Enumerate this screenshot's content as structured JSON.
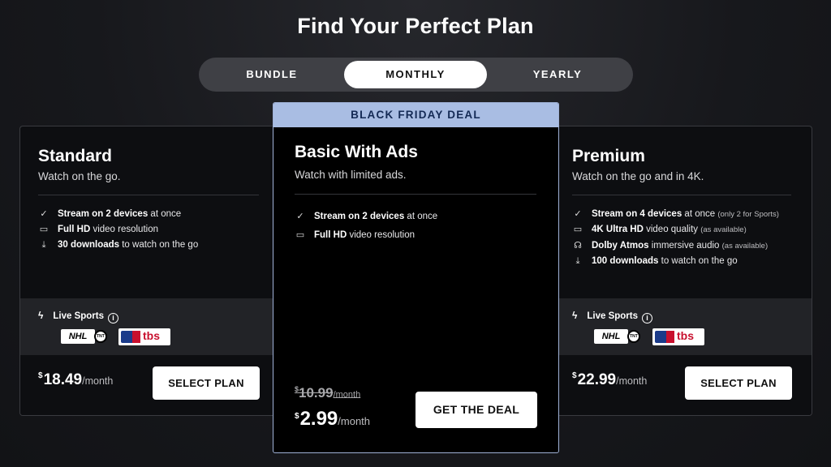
{
  "page": {
    "title": "Find Your Perfect Plan"
  },
  "billing_toggle": {
    "options": [
      "BUNDLE",
      "MONTHLY",
      "YEARLY"
    ],
    "selected": "MONTHLY"
  },
  "plans": [
    {
      "name": "Standard",
      "tagline": "Watch on the go.",
      "features": [
        {
          "icon": "check-icon",
          "bold": "Stream on 2 devices",
          "rest": " at once",
          "note": ""
        },
        {
          "icon": "monitor-icon",
          "bold": "Full HD",
          "rest": " video resolution",
          "note": ""
        },
        {
          "icon": "download-icon",
          "bold": "30 downloads",
          "rest": " to watch on the go",
          "note": ""
        }
      ],
      "live_sports_label": "Live Sports",
      "price_currency": "$",
      "price": "18.49",
      "price_period": "/month",
      "button_label": "SELECT PLAN"
    },
    {
      "banner": "BLACK FRIDAY DEAL",
      "name": "Basic With Ads",
      "tagline": "Watch with limited ads.",
      "features": [
        {
          "icon": "check-icon",
          "bold": "Stream on 2 devices",
          "rest": " at once",
          "note": ""
        },
        {
          "icon": "monitor-icon",
          "bold": "Full HD",
          "rest": " video resolution",
          "note": ""
        }
      ],
      "old_price_currency": "$",
      "old_price": "10.99",
      "old_price_period": "/month",
      "price_currency": "$",
      "price": "2.99",
      "price_period": "/month",
      "button_label": "GET THE DEAL"
    },
    {
      "name": "Premium",
      "tagline": "Watch on the go and in 4K.",
      "features": [
        {
          "icon": "check-icon",
          "bold": "Stream on 4 devices",
          "rest": " at once ",
          "note": "(only 2 for Sports)"
        },
        {
          "icon": "monitor-icon",
          "bold": "4K Ultra HD",
          "rest": " video quality ",
          "note": "(as available)"
        },
        {
          "icon": "headphones-icon",
          "bold": "Dolby Atmos",
          "rest": " immersive audio ",
          "note": "(as available)"
        },
        {
          "icon": "download-icon",
          "bold": "100 downloads",
          "rest": " to watch on the go",
          "note": ""
        }
      ],
      "live_sports_label": "Live Sports",
      "price_currency": "$",
      "price": "22.99",
      "price_period": "/month",
      "button_label": "SELECT PLAN"
    }
  ],
  "sports_logos": {
    "nhl": "NHL",
    "tnt": "TNT",
    "tbs": "tbs"
  },
  "colors": {
    "deal_banner_bg": "#a9bde3",
    "deal_banner_text": "#142a55",
    "card_bg": "#0d0e11",
    "sports_bg": "#222327"
  }
}
